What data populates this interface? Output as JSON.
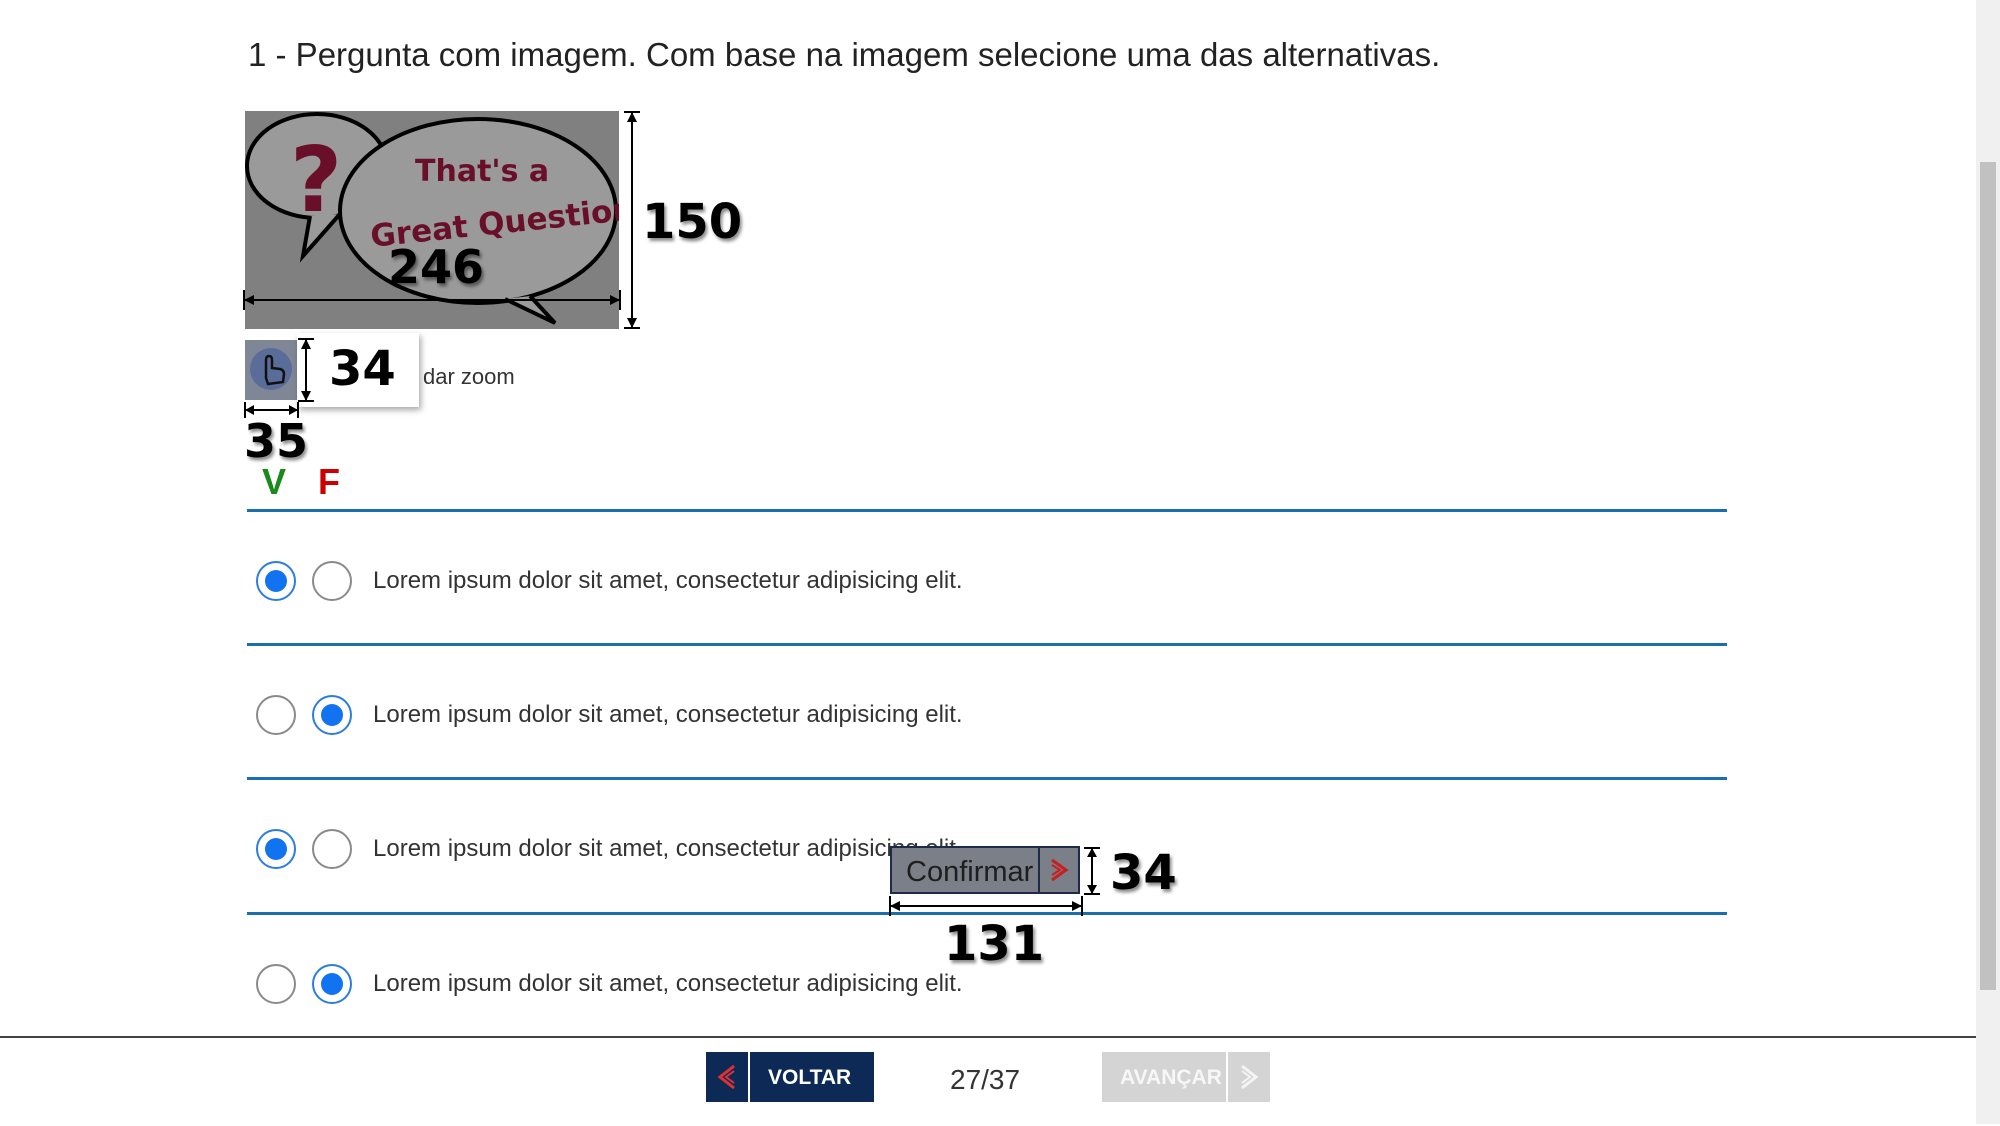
{
  "question": {
    "title": "1 - Pergunta com imagem. Com base na imagem selecione uma das alternativas.",
    "image_text_line1": "That's a",
    "image_text_line2": "Great Question!",
    "image_mark": "?",
    "zoom_text": "dar zoom"
  },
  "annotations": {
    "image_width": "246",
    "image_height": "150",
    "zoom_height": "34",
    "zoom_width": "35",
    "confirm_height": "34",
    "confirm_width": "131"
  },
  "labels": {
    "true": "V",
    "false": "F"
  },
  "alternatives": [
    {
      "text": "Lorem ipsum dolor sit amet, consectetur adipisicing elit.",
      "selected": "V"
    },
    {
      "text": "Lorem ipsum dolor sit amet, consectetur adipisicing elit.",
      "selected": "F"
    },
    {
      "text": "Lorem ipsum dolor sit amet, consectetur adipisicing elit.",
      "selected": "V"
    },
    {
      "text": "Lorem ipsum dolor sit amet, consectetur adipisicing elit.",
      "selected": "F"
    }
  ],
  "confirm": {
    "label": "Confirmar"
  },
  "footer": {
    "back_label": "VOLTAR",
    "counter": "27/37",
    "next_label": "AVANÇAR"
  },
  "colors": {
    "accent": "#1173f0",
    "line": "#1a6fb0",
    "nav": "#0d2a57",
    "true": "#1a8a1a",
    "false": "#cc0000"
  }
}
